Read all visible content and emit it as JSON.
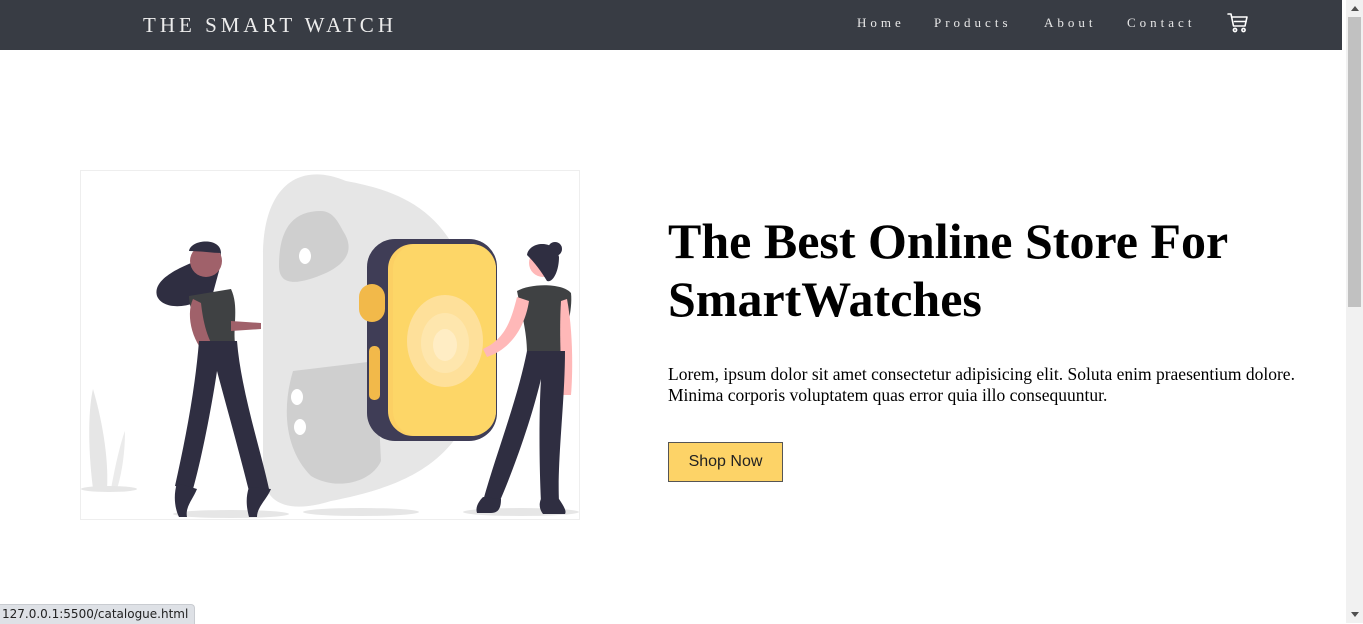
{
  "nav": {
    "brand": "THE SMART WATCH",
    "links": [
      "Home",
      "Products",
      "About",
      "Contact"
    ],
    "cart_icon": "shopping-cart-icon"
  },
  "hero": {
    "headline_line1": "The Best Online Store For",
    "headline_line2": "SmartWatches",
    "description": "Lorem, ipsum dolor sit amet consectetur adipisicing elit. Soluta enim praesentium dolore. Minima corporis voluptatem quas error quia illo consequuntur.",
    "button_label": "Shop Now"
  },
  "status_bar": {
    "url": "127.0.0.1:5500/catalogue.html"
  },
  "colors": {
    "navbar": "#383c44",
    "accent": "#fdd367",
    "watch_dark": "#3f3d56",
    "band_light": "#e6e6e6"
  }
}
